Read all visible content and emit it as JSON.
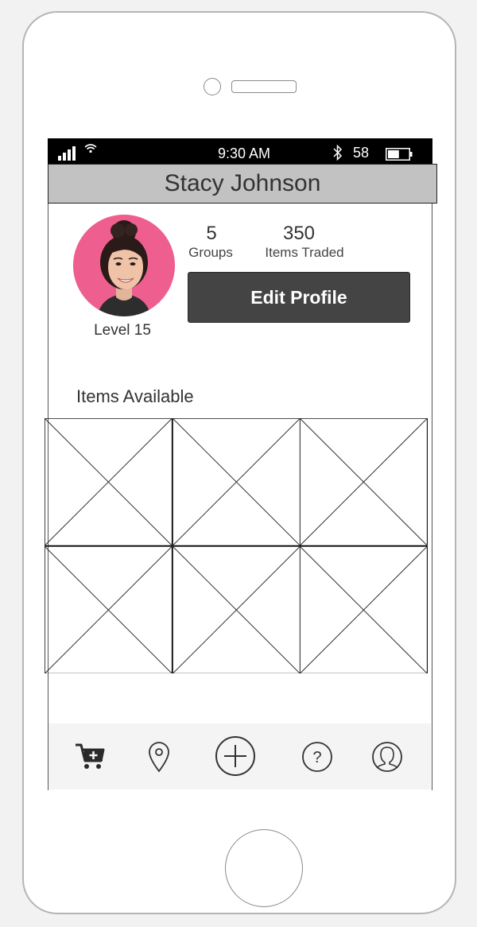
{
  "status_bar": {
    "time": "9:30 AM",
    "battery_percent": "58",
    "battery_level": 0.55,
    "signal_icon": "signal-bars-icon",
    "wifi_icon": "wifi-icon",
    "bluetooth_icon": "bluetooth-icon",
    "battery_icon": "battery-icon"
  },
  "header": {
    "title": "Stacy Johnson"
  },
  "profile": {
    "level": "Level 15",
    "stats": [
      {
        "value": "5",
        "label": "Groups"
      },
      {
        "value": "350",
        "label": "Items Traded"
      }
    ],
    "edit_button": "Edit Profile",
    "avatar_background": "#ee5f8f"
  },
  "items": {
    "title": "Items Available",
    "placeholders": 6
  },
  "tab_bar": {
    "items": [
      {
        "icon": "cart-add-icon"
      },
      {
        "icon": "location-pin-icon"
      },
      {
        "icon": "plus-circle-icon"
      },
      {
        "icon": "help-icon"
      },
      {
        "icon": "user-profile-icon"
      }
    ]
  },
  "colors": {
    "title_bar": "#c2c2c2",
    "button": "#444444",
    "tab_bar": "#f4f4f4"
  }
}
